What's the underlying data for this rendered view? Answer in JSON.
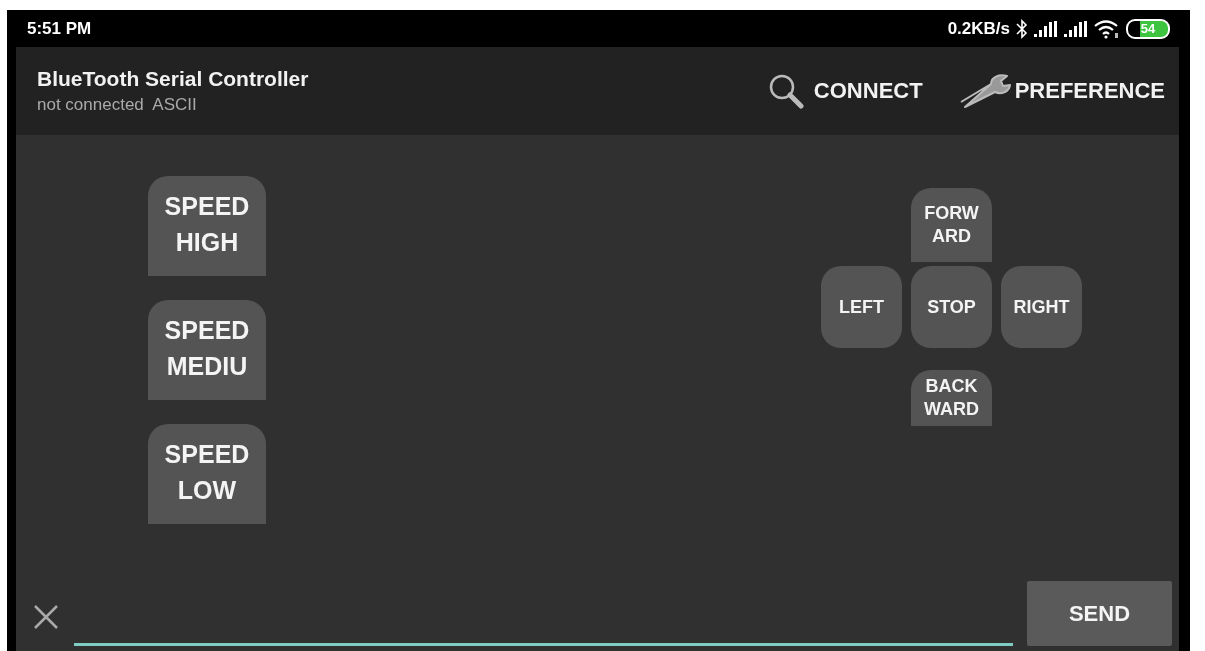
{
  "status_bar": {
    "time": "5:51 PM",
    "net_speed": "0.2KB/s",
    "battery": "54"
  },
  "app_bar": {
    "title": "BlueTooth Serial Controller",
    "subtitle": "not connected  ASCII",
    "actions": [
      {
        "kind": "search",
        "label": "CONNECT"
      },
      {
        "kind": "wrench",
        "label": "PREFERENCE"
      }
    ]
  },
  "speed_buttons": [
    "SPEED HIGH",
    "SPEED MEDIU",
    "SPEED LOW"
  ],
  "direction_pad": [
    {
      "kind": "forward",
      "label": "FORWARD"
    },
    {
      "kind": "left",
      "label": "LEFT"
    },
    {
      "kind": "stop",
      "label": "STOP"
    },
    {
      "kind": "right",
      "label": "RIGHT"
    },
    {
      "kind": "backward",
      "label": "BACKWARD"
    }
  ],
  "send_bar": {
    "button": "SEND"
  }
}
